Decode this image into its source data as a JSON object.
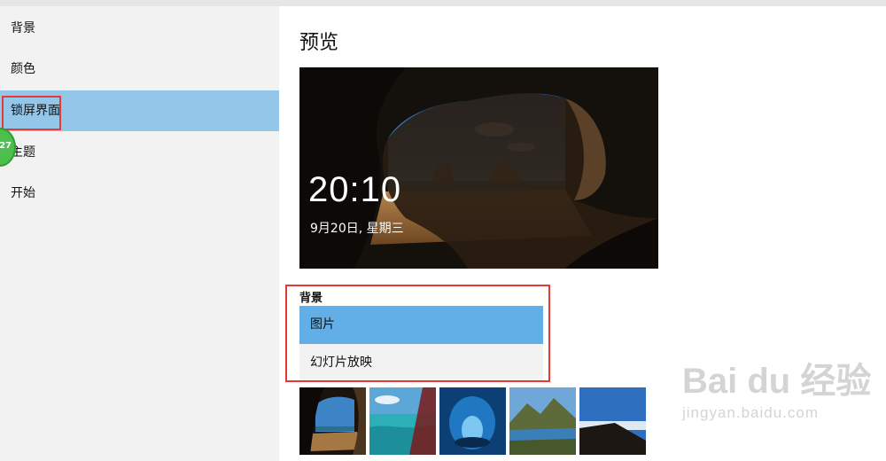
{
  "sidebar": {
    "items": [
      {
        "label": "背景"
      },
      {
        "label": "颜色"
      },
      {
        "label": "锁屏界面"
      },
      {
        "label": "主题"
      },
      {
        "label": "开始"
      }
    ],
    "step_badge": "27"
  },
  "main": {
    "title": "预览",
    "preview": {
      "time": "20:10",
      "date": "9月20日, 星期三"
    },
    "background": {
      "label": "背景",
      "options": [
        {
          "label": "图片",
          "selected": true
        },
        {
          "label": "幻灯片放映",
          "selected": false
        }
      ]
    },
    "thumbnails": [
      "cave-beach",
      "turquoise-coast",
      "blue-ice-cave",
      "mountain-lake",
      "cloud-summit"
    ]
  },
  "watermark": {
    "logo": "Bai du 经验",
    "url": "jingyan.baidu.com"
  },
  "colors": {
    "selected_nav": "#94c6ea",
    "selected_option": "#62aee6",
    "highlight": "#e53935"
  }
}
